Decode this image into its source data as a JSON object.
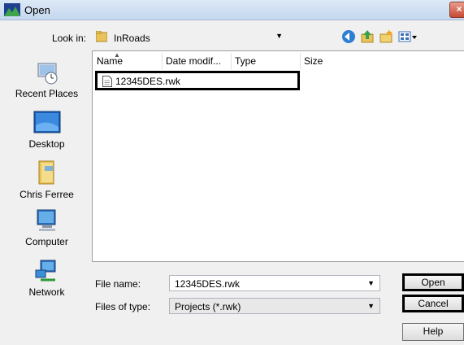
{
  "window": {
    "title": "Open",
    "close_label": "×"
  },
  "toolbar": {
    "lookin_label": "Look in:",
    "lookin_value": "InRoads",
    "icons": [
      "back-icon",
      "up-folder-icon",
      "new-folder-icon",
      "view-menu-icon"
    ]
  },
  "places": [
    {
      "label": "Recent Places",
      "icon": "recent-places-icon"
    },
    {
      "label": "Desktop",
      "icon": "desktop-icon"
    },
    {
      "label": "Chris Ferree",
      "icon": "user-folder-icon"
    },
    {
      "label": "Computer",
      "icon": "computer-icon"
    },
    {
      "label": "Network",
      "icon": "network-icon"
    }
  ],
  "columns": [
    "Name",
    "Date modif...",
    "Type",
    "Size"
  ],
  "files": [
    {
      "name": "12345DES.rwk"
    }
  ],
  "form": {
    "filename_label": "File name:",
    "filename_value": "12345DES.rwk",
    "filetype_label": "Files of type:",
    "filetype_value": "Projects (*.rwk)"
  },
  "buttons": {
    "open": "Open",
    "cancel": "Cancel",
    "help": "Help"
  }
}
